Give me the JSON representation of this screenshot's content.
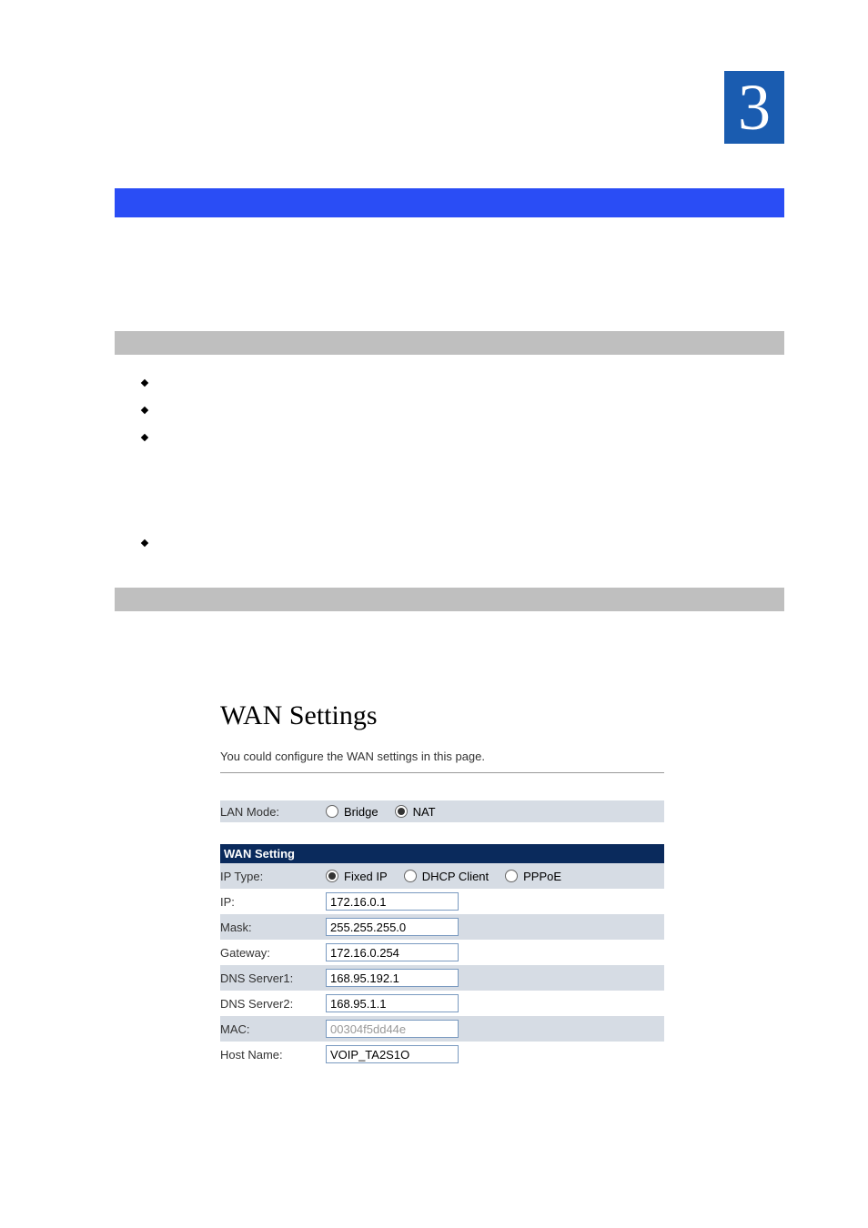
{
  "chapter_number": "3",
  "screenshot": {
    "title": "WAN Settings",
    "subtitle": "You could configure the WAN settings in this page.",
    "lan_mode": {
      "label": "LAN Mode:",
      "opt_bridge": "Bridge",
      "opt_nat": "NAT",
      "selected": "NAT"
    },
    "section_header": "WAN Setting",
    "ip_type": {
      "label": "IP Type:",
      "opt_fixed": "Fixed IP",
      "opt_dhcp": "DHCP Client",
      "opt_pppoe": "PPPoE",
      "selected": "Fixed IP"
    },
    "fields": {
      "ip": {
        "label": "IP:",
        "value": "172.16.0.1"
      },
      "mask": {
        "label": "Mask:",
        "value": "255.255.255.0"
      },
      "gateway": {
        "label": "Gateway:",
        "value": "172.16.0.254"
      },
      "dns1": {
        "label": "DNS Server1:",
        "value": "168.95.192.1"
      },
      "dns2": {
        "label": "DNS Server2:",
        "value": "168.95.1.1"
      },
      "mac": {
        "label": "MAC:",
        "value": "00304f5dd44e"
      },
      "host": {
        "label": "Host Name:",
        "value": "VOIP_TA2S1O"
      }
    }
  }
}
